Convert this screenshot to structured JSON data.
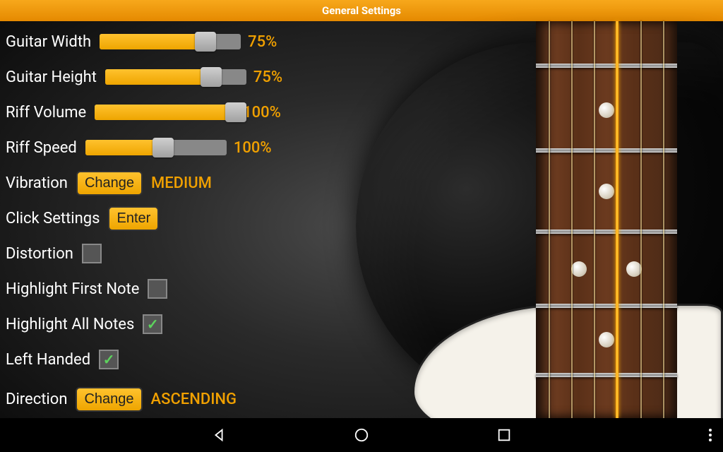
{
  "header": {
    "title": "General Settings"
  },
  "settings": {
    "sliders": [
      {
        "label": "Guitar Width",
        "percent": 75,
        "value_text": "75%"
      },
      {
        "label": "Guitar Height",
        "percent": 75,
        "value_text": "75%"
      },
      {
        "label": "Riff Volume",
        "percent": 100,
        "value_text": "100%"
      },
      {
        "label": "Riff Speed",
        "percent": 55,
        "value_text": "100%"
      }
    ],
    "vibration": {
      "label": "Vibration",
      "button": "Change",
      "value": "MEDIUM"
    },
    "click_settings": {
      "label": "Click Settings",
      "button": "Enter"
    },
    "checkboxes": [
      {
        "label": "Distortion",
        "checked": false
      },
      {
        "label": "Highlight First Note",
        "checked": false
      },
      {
        "label": "Highlight All Notes",
        "checked": true
      },
      {
        "label": "Left Handed",
        "checked": true
      }
    ],
    "direction": {
      "label": "Direction",
      "button": "Change",
      "value": "ASCENDING"
    }
  }
}
